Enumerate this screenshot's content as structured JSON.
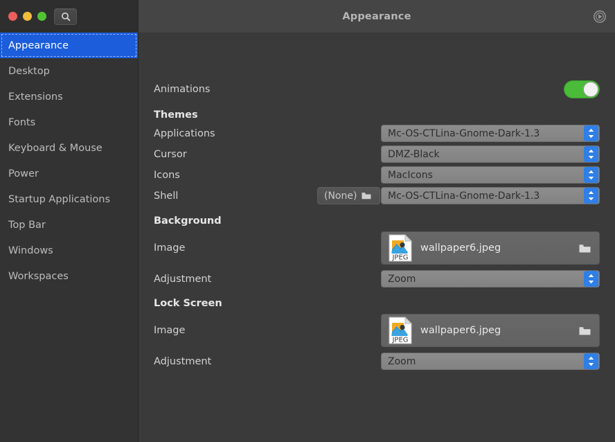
{
  "window": {
    "title": "Appearance",
    "controls": {
      "close": "close-button",
      "minimize": "minimize-button",
      "maximize": "maximize-button"
    },
    "search_icon": "search-icon",
    "menu_icon": "settings-menu-icon"
  },
  "sidebar": {
    "items": [
      {
        "label": "Appearance",
        "selected": true
      },
      {
        "label": "Desktop",
        "selected": false
      },
      {
        "label": "Extensions",
        "selected": false
      },
      {
        "label": "Fonts",
        "selected": false
      },
      {
        "label": "Keyboard & Mouse",
        "selected": false
      },
      {
        "label": "Power",
        "selected": false
      },
      {
        "label": "Startup Applications",
        "selected": false
      },
      {
        "label": "Top Bar",
        "selected": false
      },
      {
        "label": "Windows",
        "selected": false
      },
      {
        "label": "Workspaces",
        "selected": false
      }
    ]
  },
  "main": {
    "animations": {
      "label": "Animations",
      "enabled": true
    },
    "themes": {
      "heading": "Themes",
      "applications": {
        "label": "Applications",
        "value": "Mc-OS-CTLina-Gnome-Dark-1.3"
      },
      "cursor": {
        "label": "Cursor",
        "value": "DMZ-Black"
      },
      "icons": {
        "label": "Icons",
        "value": "MacIcons"
      },
      "shell": {
        "label": "Shell",
        "value": "Mc-OS-CTLina-Gnome-Dark-1.3",
        "none_button": "(None)"
      }
    },
    "background": {
      "heading": "Background",
      "image": {
        "label": "Image",
        "value": "wallpaper6.jpeg",
        "filetype": "JPEG"
      },
      "adjustment": {
        "label": "Adjustment",
        "value": "Zoom"
      }
    },
    "lock_screen": {
      "heading": "Lock Screen",
      "image": {
        "label": "Image",
        "value": "wallpaper6.jpeg",
        "filetype": "JPEG"
      },
      "adjustment": {
        "label": "Adjustment",
        "value": "Zoom"
      }
    }
  },
  "colors": {
    "accent_blue": "#1b5ddb",
    "toggle_green": "#4bbb3a",
    "dropdown_blue": "#2f7fe6",
    "sidebar_bg": "#333333",
    "content_bg": "#3a3a3a",
    "titlebar_bg": "#454545"
  }
}
